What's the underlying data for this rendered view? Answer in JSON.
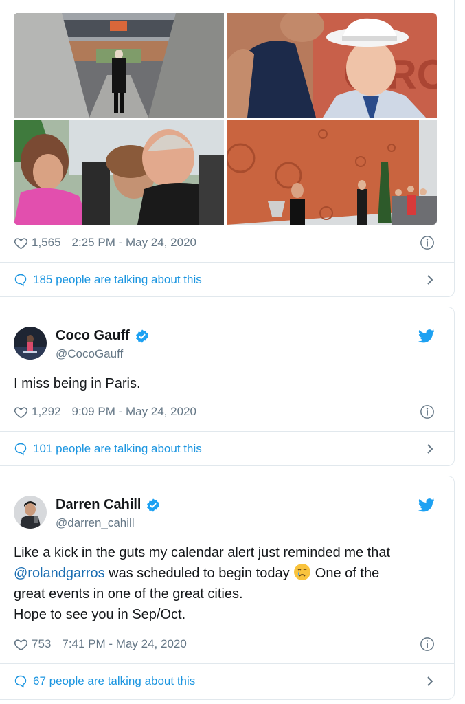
{
  "tweets": [
    {
      "likes": "1,565",
      "timestamp": "2:25 PM - May 24, 2020",
      "talking": "185 people are talking about this",
      "media": [
        {
          "icon": "photo-tunnel-man-in-suit"
        },
        {
          "icon": "photo-player-and-man-in-white-hat"
        },
        {
          "icon": "photo-crowd-embrace"
        },
        {
          "icon": "photo-trophy-by-clay-wall"
        }
      ]
    },
    {
      "name": "Coco Gauff",
      "handle": "@CocoGauff",
      "text": "I miss being in Paris.",
      "likes": "1,292",
      "timestamp": "9:09 PM - May 24, 2020",
      "talking": "101 people are talking about this"
    },
    {
      "name": "Darren Cahill",
      "handle": "@darren_cahill",
      "text_line1": "Like a kick in the guts my calendar alert just reminded me that",
      "mention": "@rolandgarros",
      "text_line2_rest": " was scheduled to begin today ",
      "emoji": "crying-face",
      "text_line2_end": " One of the",
      "text_line3": "great events in one of the great cities.",
      "text_line4": "Hope to see you in Sep/Oct.",
      "likes": "753",
      "timestamp": "7:41 PM - May 24, 2020",
      "talking": "67 people are talking about this"
    }
  ],
  "colors": {
    "link": "#1b95e0",
    "muted": "#657786",
    "border": "#e1e8ed",
    "verified": "#1da1f2",
    "clay": "#c9643f"
  }
}
